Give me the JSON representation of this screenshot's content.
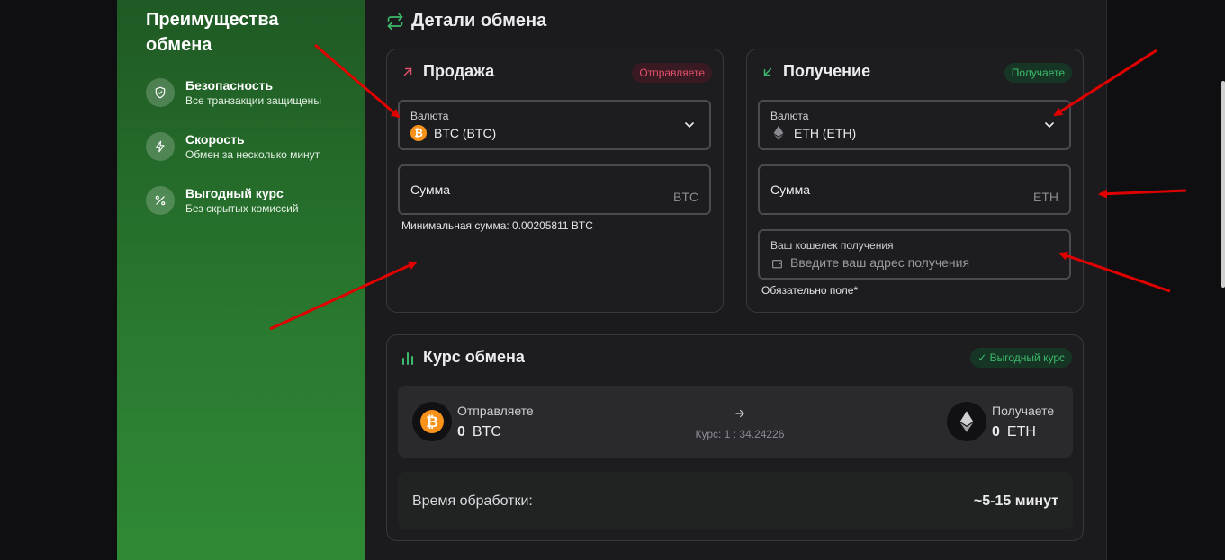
{
  "sidebar": {
    "title": "Преимущества обмена",
    "benefits": [
      {
        "title": "Безопасность",
        "subtitle": "Все транзакции защищены",
        "icon": "shield-icon"
      },
      {
        "title": "Скорость",
        "subtitle": "Обмен за несколько минут",
        "icon": "lightning-icon"
      },
      {
        "title": "Выгодный курс",
        "subtitle": "Без скрытых комиссий",
        "icon": "percent-icon"
      }
    ]
  },
  "main": {
    "title": "Детали обмена"
  },
  "sell": {
    "title": "Продажа",
    "badge": "Отправляете",
    "currency_label": "Валюта",
    "currency_value": "BTC (BTC)",
    "amount_label": "Сумма",
    "amount_unit": "BTC",
    "min_hint": "Минимальная сумма: 0.00205811 BTC"
  },
  "receive": {
    "title": "Получение",
    "badge": "Получаете",
    "currency_label": "Валюта",
    "currency_value": "ETH (ETH)",
    "amount_label": "Сумма",
    "amount_unit": "ETH",
    "wallet_label": "Ваш кошелек получения",
    "wallet_placeholder": "Введите ваш адрес получения",
    "required_hint": "Обязательно поле*"
  },
  "rate": {
    "title": "Курс обмена",
    "badge": "Выгодный курс",
    "send_label": "Отправляете",
    "send_amount": "0",
    "send_currency": "BTC",
    "rate_text": "Курс: 1 : 34.24226",
    "receive_label": "Получаете",
    "receive_amount": "0",
    "receive_currency": "ETH",
    "time_label": "Время обработки:",
    "time_value": "~5-15 минут"
  },
  "colors": {
    "accent_green": "#2f8a35",
    "sell_accent": "#e0506a",
    "receive_accent": "#3dbb6c",
    "btc_orange": "#f7931a",
    "annotation_red": "#e00000"
  }
}
